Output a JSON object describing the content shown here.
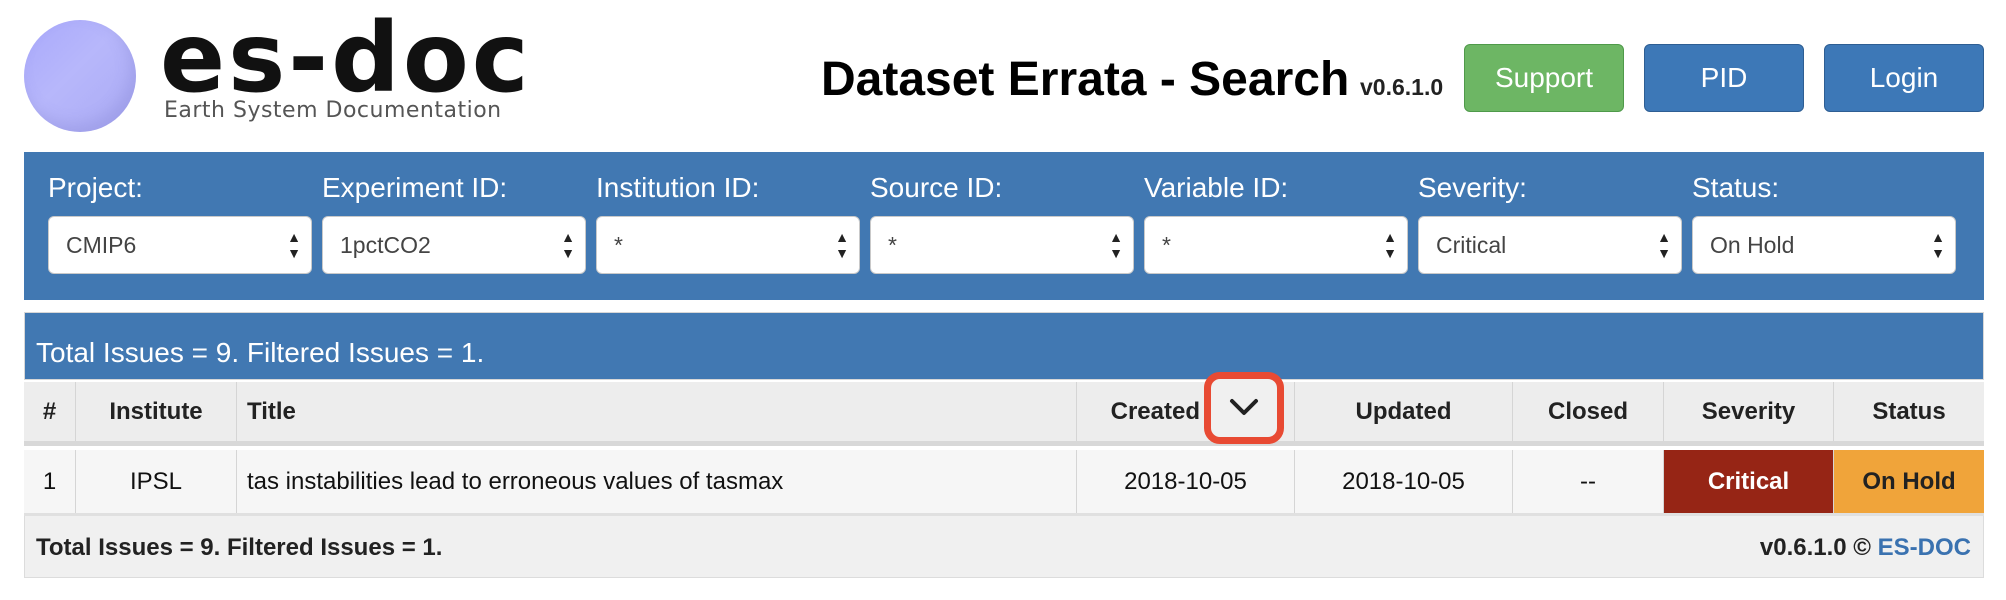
{
  "header": {
    "logo": {
      "name": "es-doc",
      "tagline": "Earth System Documentation"
    },
    "title": "Dataset Errata - Search",
    "version": "v0.6.1.0",
    "buttons": {
      "support": "Support",
      "pid": "PID",
      "login": "Login"
    }
  },
  "filters": [
    {
      "label": "Project:",
      "value": "CMIP6"
    },
    {
      "label": "Experiment ID:",
      "value": "1pctCO2"
    },
    {
      "label": "Institution ID:",
      "value": "*"
    },
    {
      "label": "Source ID:",
      "value": "*"
    },
    {
      "label": "Variable ID:",
      "value": "*"
    },
    {
      "label": "Severity:",
      "value": "Critical"
    },
    {
      "label": "Status:",
      "value": "On Hold"
    }
  ],
  "summary": "Total Issues = 9. Filtered Issues = 1.",
  "table": {
    "columns": [
      "#",
      "Institute",
      "Title",
      "Created",
      "Updated",
      "Closed",
      "Severity",
      "Status"
    ],
    "rows": [
      [
        "1",
        "IPSL",
        "tas instabilities lead to erroneous values of tasmax",
        "2018-10-05",
        "2018-10-05",
        "--",
        "Critical",
        "On Hold"
      ]
    ]
  },
  "footer": {
    "summary": "Total Issues = 9. Filtered Issues = 1.",
    "version": "v0.6.1.0 ©",
    "link": "ES-DOC"
  },
  "colors": {
    "primary": "#4178b2",
    "support": "#6db664",
    "severity_critical": "#962515",
    "status_on_hold": "#f0a43a",
    "highlight": "#e84a33"
  }
}
